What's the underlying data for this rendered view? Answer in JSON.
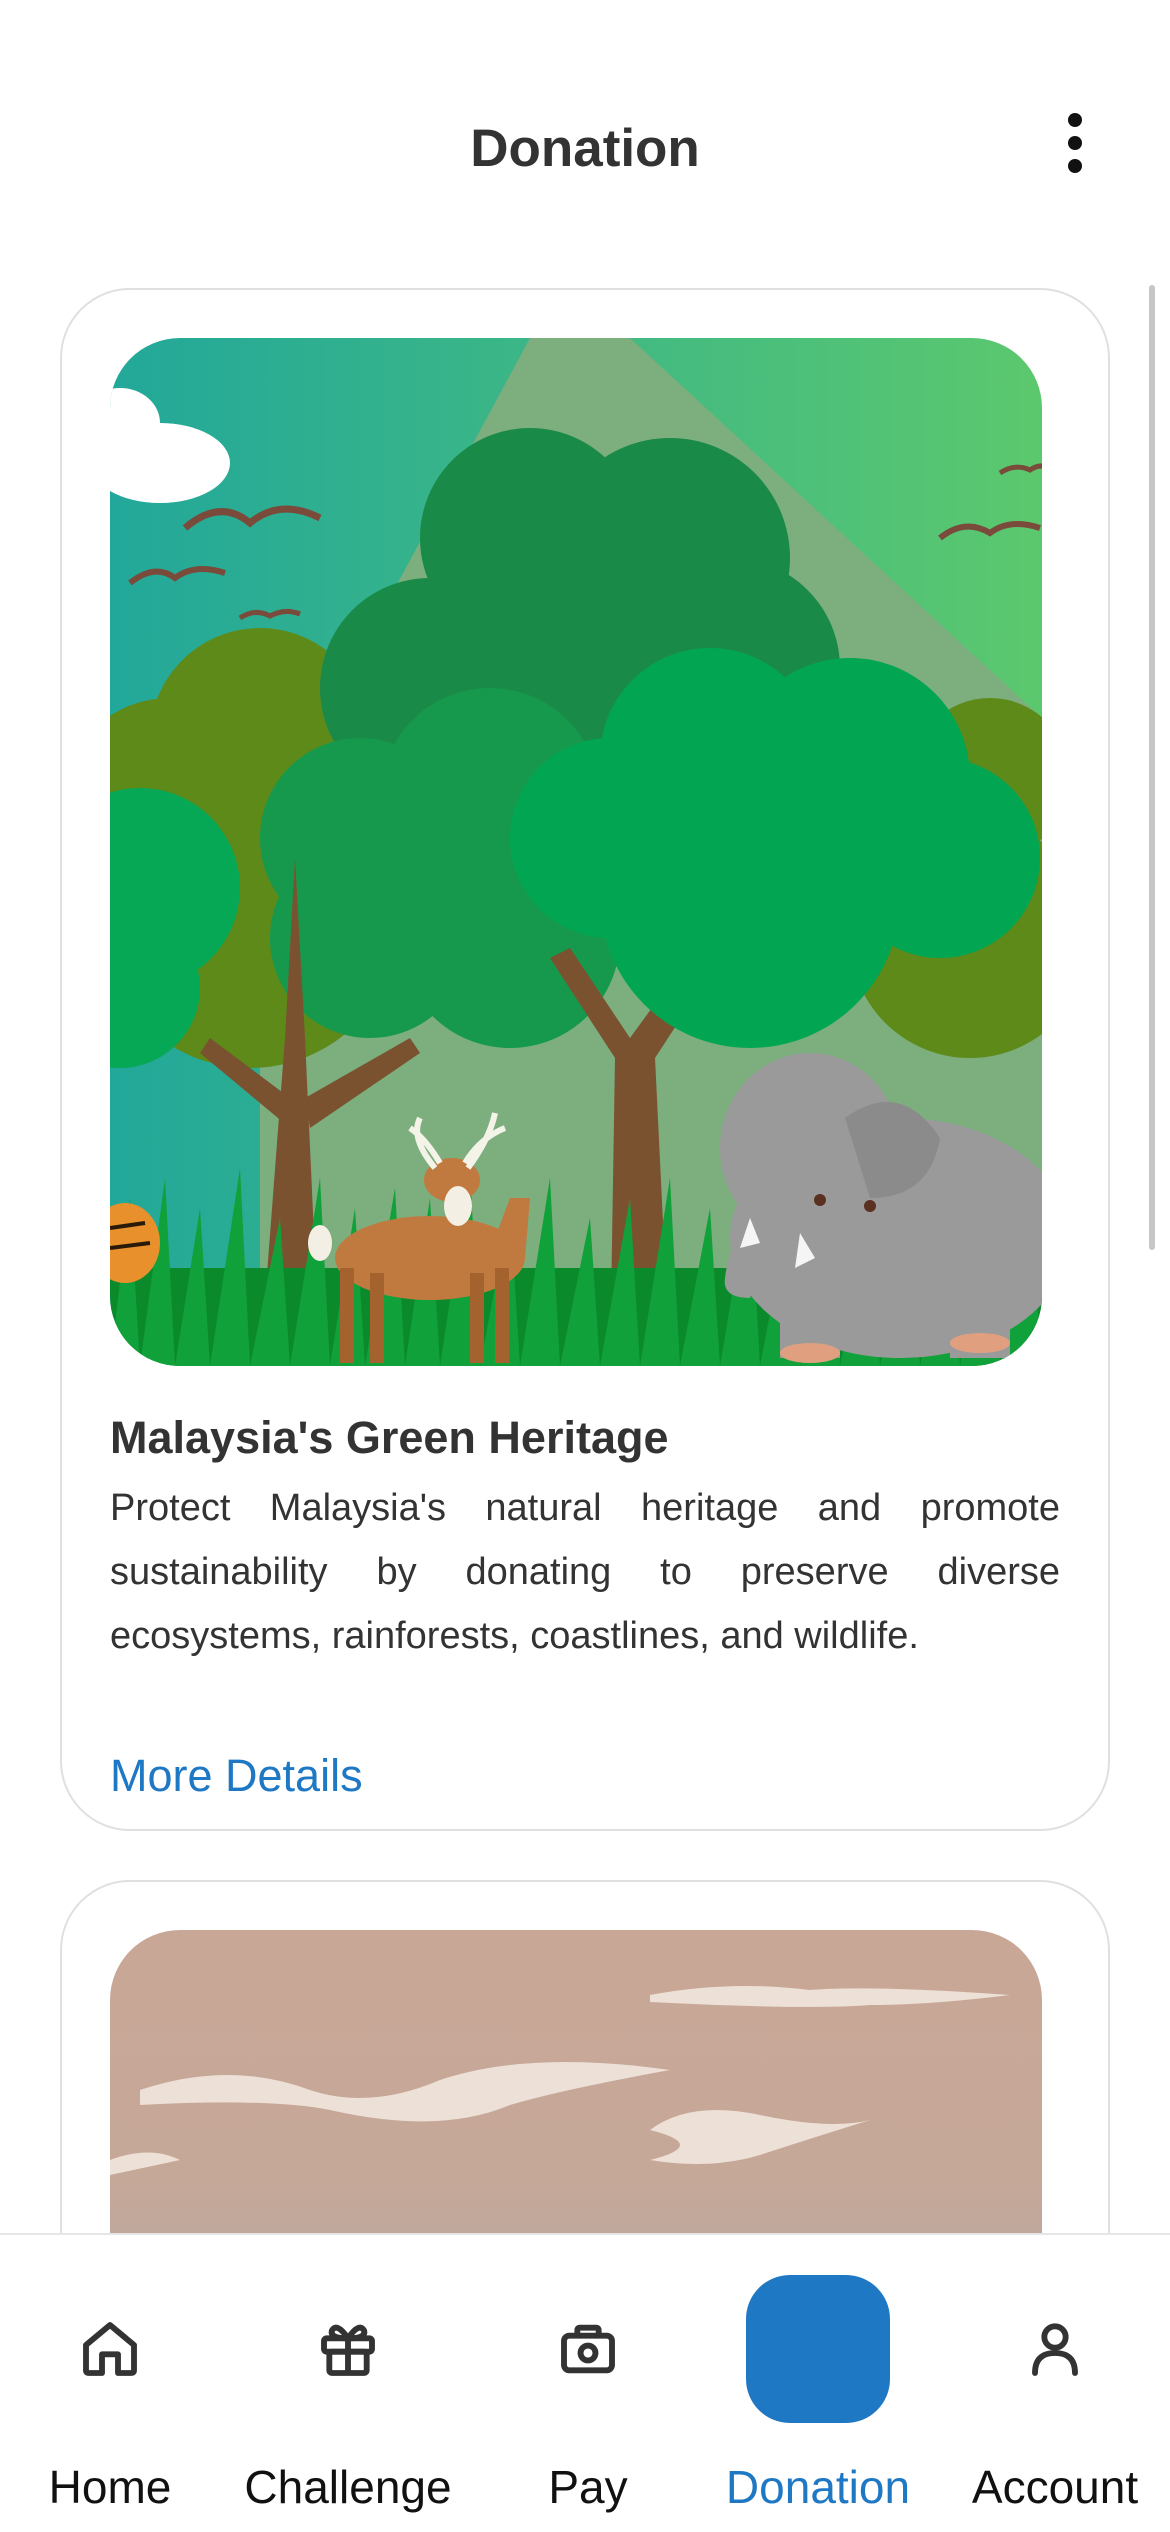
{
  "header": {
    "title": "Donation",
    "menu_icon": "more-vertical-icon"
  },
  "cards": [
    {
      "image": "malaysia-rainforest-wildlife-illustration",
      "title": "Malaysia's Green Heritage",
      "description": "Protect Malaysia's natural heritage and promote sustainability by donating to preserve diverse ecosystems, rainforests, coastlines, and wildlife.",
      "link": "More Details"
    },
    {
      "image": "beach-palm-illustration"
    }
  ],
  "nav": {
    "items": [
      {
        "label": "Home",
        "icon": "home-icon"
      },
      {
        "label": "Challenge",
        "icon": "gift-icon"
      },
      {
        "label": "Pay",
        "icon": "camera-wallet-icon"
      },
      {
        "label": "Donation",
        "icon": "star-icon",
        "active": true
      },
      {
        "label": "Account",
        "icon": "user-icon"
      }
    ]
  },
  "colors": {
    "accent": "#1f78c4",
    "text": "#333333",
    "card_border": "#e0e0e0"
  }
}
